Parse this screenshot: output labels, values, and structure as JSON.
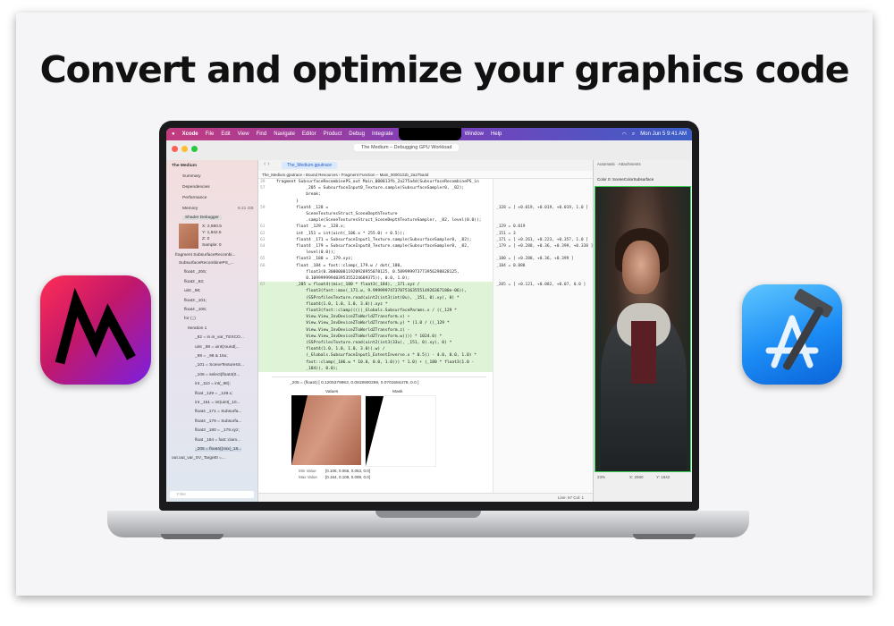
{
  "headline": "Convert and optimize your graphics code",
  "menubar": {
    "app": "Xcode",
    "items": [
      "File",
      "Edit",
      "View",
      "Find",
      "Navigate",
      "Editor",
      "Product",
      "Debug",
      "Integrate"
    ],
    "right_items": [
      "Window",
      "Help"
    ],
    "clock": "Mon Jun 5  9:41 AM"
  },
  "window_title": "The Medium – Debugging GPU Workload",
  "tab_label": "The_Medium.gputrace",
  "pathbar": "The_Medium.gputrace  ›  Bound Resources  ›  Fragment Function – Main_0000131b_2a275a4d",
  "sidebar": {
    "project": "The Medium",
    "items": [
      "Summary",
      "Dependencies",
      "Performance",
      "Memory"
    ],
    "memory_size": "8.21 GB",
    "shader_debugger": "Shader Debugger",
    "pixel": {
      "x": "X: 2,560.5",
      "y": "Y: 1,842.5",
      "z": "Z: 0",
      "sample": "Sample: 0"
    },
    "fragment": "fragment SubsurfaceRecombi...",
    "tree": [
      "SubsurfaceRecombinePS_...",
      "float4 _205;",
      "float2 _82;",
      "uint _98;",
      "float3 _101;",
      "float4 _106;",
      "for (;;)",
      "Iteration 1",
      "_82 = in.in_var_TEXCO...",
      "uint _98 = uint(round(...",
      "_98 = _98 & 15u;",
      "_101 = SceneTexturesS...",
      "_106 = select(float4(0...",
      "int _110 = int(_98);",
      "float _129 = _128.x;",
      "int _151 = int(uint(_10...",
      "float4 _171 = Subsurfa...",
      "float4 _179 = Subsurfa...",
      "float3 _180 = _179.xyz;",
      "float _184 = fast::clam...",
      "_205 = float4((mix(_18...",
      "out.out_var_SV_Target0 =..."
    ],
    "filter_placeholder": "Filter"
  },
  "code_lines": [
    {
      "n": "39",
      "t": "fragment SubsurfaceRecombinePS_out Main_000013fb_2a275a4d(SubsurfaceRecombinePS_in"
    },
    {
      "n": "57",
      "t": "            _205 = SubsurfaceInput0_Texture.sample(SubsurfaceSampler0, _82);"
    },
    {
      "n": "",
      "t": "            break;"
    },
    {
      "n": "",
      "t": "        }"
    },
    {
      "n": "59",
      "t": "        float4 _128 ="
    },
    {
      "n": "",
      "t": "            SceneTexturesStruct_SceneDepthTexture"
    },
    {
      "n": "",
      "t": "            .sample(SceneTexturesStruct_SceneDepthTextureSampler, _82, level(0.0));"
    },
    {
      "n": "61",
      "t": "        float _129 = _128.x;"
    },
    {
      "n": "62",
      "t": "        int _151 = int(uint(_106.x * 255.0) + 0.5));"
    },
    {
      "n": "63",
      "t": "        float4 _171 = SubsurfaceInput1_Texture.sample(SubsurfaceSampler0, _82);"
    },
    {
      "n": "64",
      "t": "        float4 _179 = SubsurfaceInput0_Texture.sample(SubsurfaceSampler0, _82,"
    },
    {
      "n": "",
      "t": "            level(0.0));"
    },
    {
      "n": "65",
      "t": "        float3 _180 = _179.xyz;"
    },
    {
      "n": "66",
      "t": "        float _184 = fast::clamp(_179.w / dot(_180,"
    },
    {
      "n": "",
      "t": "            float3(0.300000011920928955078125, 0.589999973773956298828125,"
    },
    {
      "n": "",
      "t": "            0.10999999940395355224609375)), 0.0, 1.0);"
    },
    {
      "n": "67",
      "t": "        _205 = float4((mix(_180 * float3(_184), _171.xyz /"
    },
    {
      "n": "",
      "t": "            float3(fast::max(_171.w, 9.9999997473787516355514926367188e-06)),"
    },
    {
      "n": "",
      "t": "            (SSProfilesTexture.read(uint2(int3(int(0u), _151, 0).xy), 0) *"
    },
    {
      "n": "",
      "t": "            float4(1.0, 1.0, 1.0, 3.0)).xyz *"
    },
    {
      "n": "",
      "t": "            float3(fast::clamp(((((_Globals.SubsurfaceParams.x / ((_129 *"
    },
    {
      "n": "",
      "t": "            View.View_InvDeviceZToWorldZTransform.x) +"
    },
    {
      "n": "",
      "t": "            View.View_InvDeviceZToWorldZTransform.y) * (1.0 / ((_129 *"
    },
    {
      "n": "",
      "t": "            View.View_InvDeviceZToWorldZTransform.z) -"
    },
    {
      "n": "",
      "t": "            View.View_InvDeviceZToWorldZTransform.w)))) * 1024.0) *"
    },
    {
      "n": "",
      "t": "            (SSProfilesTexture.read(uint2(int3(33u), _151, 0).xy), 0) *"
    },
    {
      "n": "",
      "t": "            float4(1.0, 1.0, 1.0, 3.0)).w) /"
    },
    {
      "n": "",
      "t": "            (_Globals.SubsurfaceInput1_ExtentInverse.x * 0.5)) - 4.0, 0.0, 1.0) *"
    },
    {
      "n": "",
      "t": "            fast::clamp(_106.w * 10.0, 0.0, 1.0))) * 1.0) + (_180 * float3(1.0 -"
    },
    {
      "n": "",
      "t": "            _184)), 0.0);"
    }
  ],
  "annotations": [
    {
      "row": 4,
      "t": "_128 = [ +0.019, +0.019, +0.019, 1.0 ]"
    },
    {
      "row": 7,
      "t": "_129 = 0.019"
    },
    {
      "row": 8,
      "t": "_151 = 3"
    },
    {
      "row": 9,
      "t": "_171 = [ +0.261, +0.223, +0.357, 1.0 ]"
    },
    {
      "row": 10,
      "t": "_179 = [ +0.288, +0.36, +0.399, +0.338 ]"
    },
    {
      "row": 12,
      "t": "_180 = [ +0.288, +0.36, +0.399 ]"
    },
    {
      "row": 13,
      "t": "_184 = 0.888"
    },
    {
      "row": 16,
      "t": "_205 = [ +0.121, +0.082, +0.07, 0.0 ]"
    }
  ],
  "popup": {
    "value": "_205 = (float4) [ 0.1205379963, 0.0819900259, 0.0701684478, 0.0 ]",
    "col_values": "Values",
    "col_mask": "Mask",
    "min_label": "Min Value",
    "min_val": "[0.106, 0.066, 0.053, 0.0]",
    "max_label": "Max Value",
    "max_val": "[0.164, 0.109, 0.099, 0.0]"
  },
  "image_pane": {
    "header": "Color 0: SceneColorSubsurface",
    "mode": "Automatic",
    "attachments": "Attachments",
    "zoom": "23%",
    "coord_x": "X: 2560",
    "coord_y": "Y: 1842"
  },
  "status": "Line: 67  Col: 1",
  "colors": {
    "metal_top": "#ff2d55",
    "metal_bottom": "#7b1fe0",
    "xcode_blue": "#1b8cf5",
    "highlight": "#dff3d7"
  }
}
